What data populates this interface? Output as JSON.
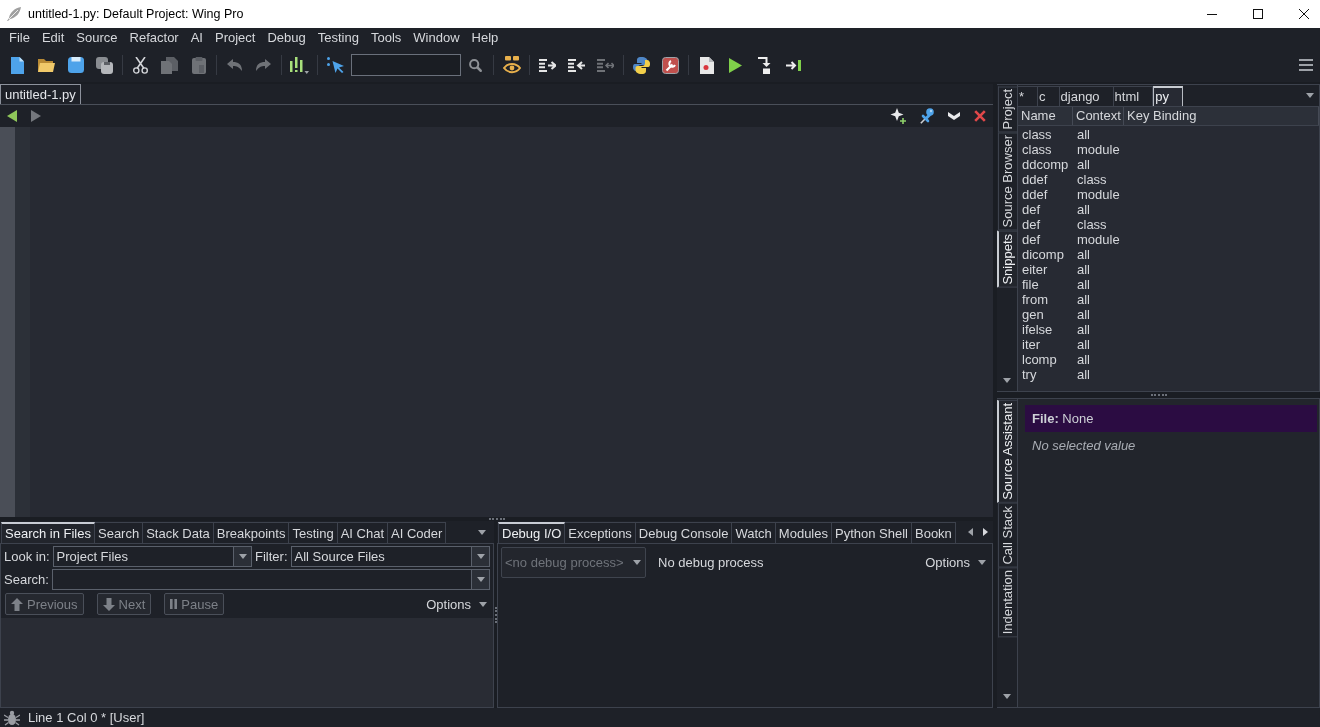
{
  "window": {
    "title": "untitled-1.py: Default Project: Wing Pro"
  },
  "menu_bar": [
    "File",
    "Edit",
    "Source",
    "Refactor",
    "AI",
    "Project",
    "Debug",
    "Testing",
    "Tools",
    "Window",
    "Help"
  ],
  "toolbar": {
    "groups": [
      [
        {
          "disabled": false
        },
        {
          "disabled": false
        },
        {
          "disabled": false
        },
        {
          "disabled": false
        }
      ],
      [
        {
          "disabled": false
        },
        {
          "disabled": true
        },
        {
          "disabled": true
        }
      ],
      [
        {
          "disabled": true
        },
        {
          "disabled": true
        }
      ],
      [
        {
          "disabled": false
        }
      ],
      [
        {
          "disabled": false
        },
        {
          "disabled": false
        }
      ],
      [
        {
          "disabled": false
        }
      ],
      [
        {
          "disabled": false
        },
        {
          "disabled": false
        },
        {
          "disabled": true
        }
      ],
      [
        {
          "disabled": false
        },
        {
          "disabled": false
        }
      ],
      [
        {
          "disabled": false
        },
        {
          "disabled": false
        },
        {
          "disabled": false
        },
        {
          "disabled": false
        }
      ]
    ]
  },
  "editor": {
    "tabs": [
      {
        "label": "untitled-1.py",
        "selected": true
      }
    ],
    "back": {
      "disabled": false
    },
    "forward": {
      "disabled": true
    }
  },
  "search_panel": {
    "tabs": [
      {
        "label": "Search in Files",
        "selected": true
      },
      {
        "label": "Search",
        "selected": false
      },
      {
        "label": "Stack Data",
        "selected": false
      },
      {
        "label": "Breakpoints",
        "selected": false
      },
      {
        "label": "Testing",
        "selected": false
      },
      {
        "label": "AI Chat",
        "selected": false
      },
      {
        "label": "AI Coder",
        "selected": false
      }
    ],
    "look_in": {
      "label": "Look in:",
      "value": "Project Files"
    },
    "filter": {
      "label": "Filter:",
      "value": "All Source Files"
    },
    "search": {
      "label": "Search:"
    },
    "buttons": [
      {
        "label": "Previous",
        "disabled": true
      },
      {
        "label": "Next",
        "disabled": true
      },
      {
        "label": "Pause",
        "disabled": true
      }
    ],
    "options": "Options"
  },
  "debug_panel": {
    "tabs": [
      {
        "label": "Debug I/O",
        "selected": true
      },
      {
        "label": "Exceptions",
        "selected": false
      },
      {
        "label": "Debug Console",
        "selected": false
      },
      {
        "label": "Watch",
        "selected": false
      },
      {
        "label": "Modules",
        "selected": false
      },
      {
        "label": "Python Shell",
        "selected": false
      },
      {
        "label": "Bookn",
        "selected": false
      }
    ],
    "process": {
      "value": "<no debug process>",
      "disabled": true
    },
    "status": "No debug process",
    "options": "Options"
  },
  "snippets_panel": {
    "side_tabs": [
      {
        "label": "Project",
        "selected": false
      },
      {
        "label": "Source Browser",
        "selected": false
      },
      {
        "label": "Snippets",
        "selected": true
      }
    ],
    "filter_tabs": [
      {
        "label": "*",
        "selected": false
      },
      {
        "label": "c",
        "selected": false
      },
      {
        "label": "django",
        "selected": false
      },
      {
        "label": "html",
        "selected": false
      },
      {
        "label": "py",
        "selected": true
      }
    ],
    "table": {
      "columns": [
        "Name",
        "Context",
        "Key Binding"
      ],
      "rows": [
        [
          "class",
          "all"
        ],
        [
          "class",
          "module"
        ],
        [
          "ddcomp",
          "all"
        ],
        [
          "ddef",
          "class"
        ],
        [
          "ddef",
          "module"
        ],
        [
          "def",
          "all"
        ],
        [
          "def",
          "class"
        ],
        [
          "def",
          "module"
        ],
        [
          "dicomp",
          "all"
        ],
        [
          "eiter",
          "all"
        ],
        [
          "file",
          "all"
        ],
        [
          "from",
          "all"
        ],
        [
          "gen",
          "all"
        ],
        [
          "ifelse",
          "all"
        ],
        [
          "iter",
          "all"
        ],
        [
          "lcomp",
          "all"
        ],
        [
          "try",
          "all"
        ]
      ]
    }
  },
  "assistant_panel": {
    "side_tabs": [
      {
        "label": "Source Assistant",
        "selected": true
      },
      {
        "label": "Call Stack",
        "selected": false
      },
      {
        "label": "Indentation",
        "selected": false
      }
    ],
    "header": "**File:** None",
    "message": "No selected value"
  },
  "status_bar": {
    "text": "Line 1 Col 0 * [User]"
  }
}
